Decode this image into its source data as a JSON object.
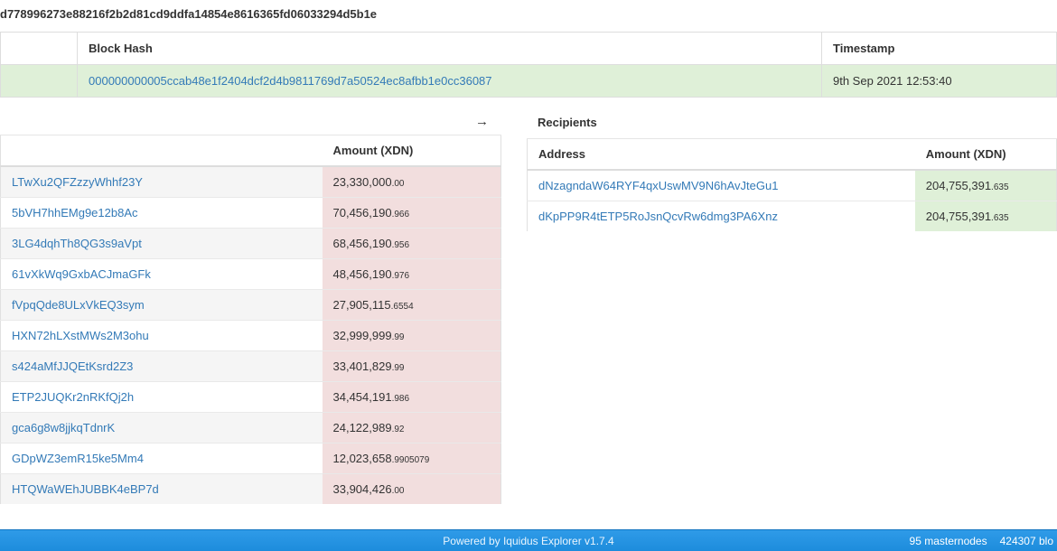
{
  "tx_hash": "d778996273e88216f2b2d81cd9ddfa14854e8616365fd06033294d5b1e",
  "block_table": {
    "headers": {
      "index": "",
      "hash": "Block Hash",
      "timestamp": "Timestamp"
    },
    "row": {
      "index": "",
      "hash": "000000000005ccab48e1f2404dcf2d4b9811769d7a50524ec8afbb1e0cc36087",
      "timestamp": "9th Sep 2021 12:53:40"
    }
  },
  "arrow_icon": "→",
  "senders": {
    "headers": {
      "address": "",
      "amount": "Amount (XDN)"
    },
    "rows": [
      {
        "address": "LTwXu2QFZzzyWhhf23Y",
        "int": "23,330,000",
        "frac": ".00"
      },
      {
        "address": "5bVH7hhEMg9e12b8Ac",
        "int": "70,456,190",
        "frac": ".966"
      },
      {
        "address": "3LG4dqhTh8QG3s9aVpt",
        "int": "68,456,190",
        "frac": ".956"
      },
      {
        "address": "61vXkWq9GxbACJmaGFk",
        "int": "48,456,190",
        "frac": ".976"
      },
      {
        "address": "fVpqQde8ULxVkEQ3sym",
        "int": "27,905,115",
        "frac": ".6554"
      },
      {
        "address": "HXN72hLXstMWs2M3ohu",
        "int": "32,999,999",
        "frac": ".99"
      },
      {
        "address": "s424aMfJJQEtKsrd2Z3",
        "int": "33,401,829",
        "frac": ".99"
      },
      {
        "address": "ETP2JUQKr2nRKfQj2h",
        "int": "34,454,191",
        "frac": ".986"
      },
      {
        "address": "gca6g8w8jjkqTdnrK",
        "int": "24,122,989",
        "frac": ".92"
      },
      {
        "address": "GDpWZ3emR15ke5Mm4",
        "int": "12,023,658",
        "frac": ".9905079"
      },
      {
        "address": "HTQWaWEhJUBBK4eBP7d",
        "int": "33,904,426",
        "frac": ".00"
      }
    ]
  },
  "recipients": {
    "title": "Recipients",
    "headers": {
      "address": "Address",
      "amount": "Amount (XDN)"
    },
    "rows": [
      {
        "address": "dNzagndaW64RYF4qxUswMV9N6hAvJteGu1",
        "int": "204,755,391",
        "frac": ".635"
      },
      {
        "address": "dKpPP9R4tETP5RoJsnQcvRw6dmg3PA6Xnz",
        "int": "204,755,391",
        "frac": ".635"
      }
    ]
  },
  "footer": {
    "powered": "Powered by Iquidus Explorer v1.7.4",
    "masternodes": "95 masternodes",
    "blocks": "424307 blo"
  }
}
